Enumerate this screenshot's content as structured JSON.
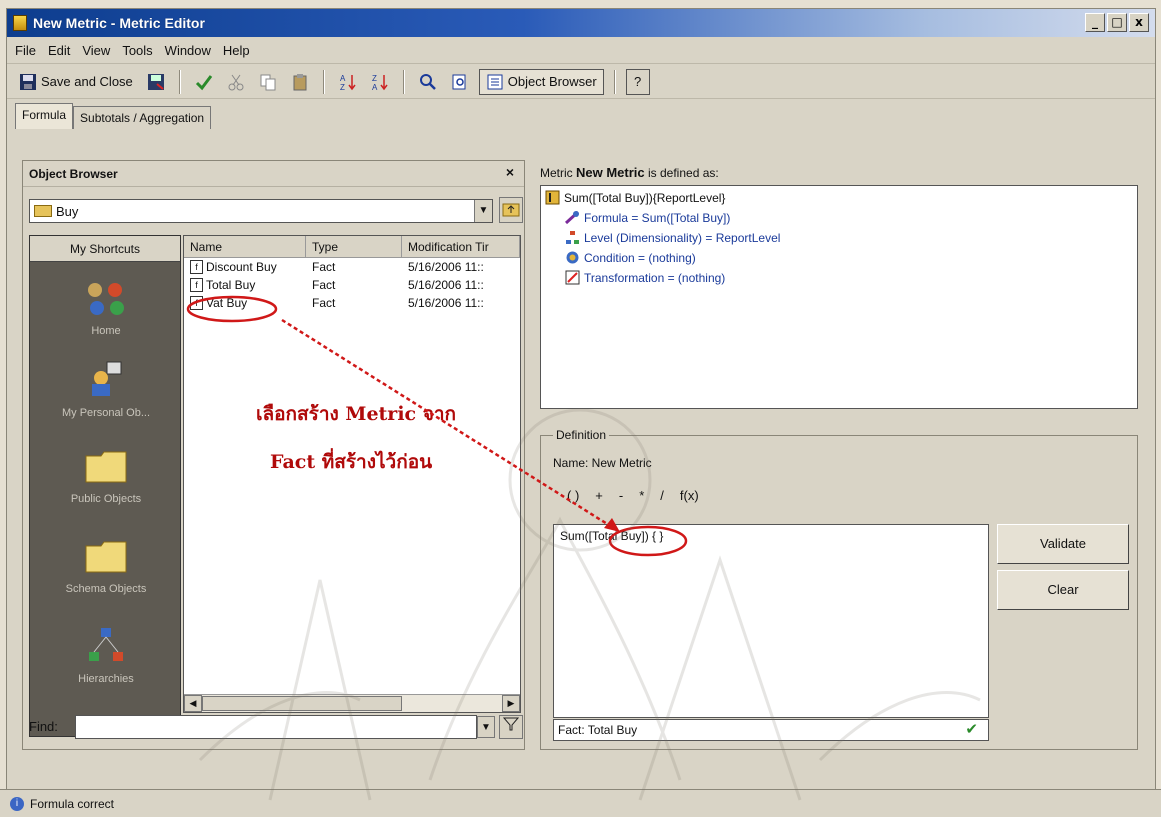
{
  "window": {
    "title": "New Metric - Metric Editor",
    "controls": [
      "_",
      "□",
      "x"
    ]
  },
  "menu": [
    "File",
    "Edit",
    "View",
    "Tools",
    "Window",
    "Help"
  ],
  "toolbar": {
    "save_close": "Save and Close",
    "object_browser": "Object Browser",
    "help": "?"
  },
  "tabs": [
    "Formula",
    "Subtotals / Aggregation"
  ],
  "object_browser": {
    "title": "Object Browser",
    "close": "×",
    "folder": "Buy",
    "shortcuts_header": "My Shortcuts",
    "shortcuts": [
      "Home",
      "My Personal Ob...",
      "Public Objects",
      "Schema Objects",
      "Hierarchies"
    ],
    "columns": [
      "Name",
      "Type",
      "Modification Tir"
    ],
    "rows": [
      {
        "name": "Discount Buy",
        "type": "Fact",
        "modified": "5/16/2006 11::"
      },
      {
        "name": "Total Buy",
        "type": "Fact",
        "modified": "5/16/2006 11::"
      },
      {
        "name": "Vat Buy",
        "type": "Fact",
        "modified": "5/16/2006 11::"
      }
    ],
    "find_label": "Find:"
  },
  "metric": {
    "prefix": "Metric",
    "name": "New Metric",
    "suffix": "is defined as:",
    "tree": {
      "root": "Sum([Total Buy]){ReportLevel}",
      "formula": "Formula = Sum([Total Buy])",
      "level": "Level (Dimensionality) = ReportLevel",
      "condition": "Condition = (nothing)",
      "transformation": "Transformation = (nothing)"
    }
  },
  "definition": {
    "legend": "Definition",
    "name_label": "Name: New Metric",
    "operators": [
      "( )",
      "+",
      "-",
      "*",
      "/",
      "f(x)"
    ],
    "formula_text": "Sum([Total Buy]) { }",
    "status": "Fact: Total Buy",
    "validate": "Validate",
    "clear": "Clear"
  },
  "statusbar": {
    "text": "Formula correct"
  },
  "annotation": {
    "line1": "เลือกสร้าง Metric จาก",
    "line2": "Fact ที่สร้างไว้ก่อน"
  }
}
